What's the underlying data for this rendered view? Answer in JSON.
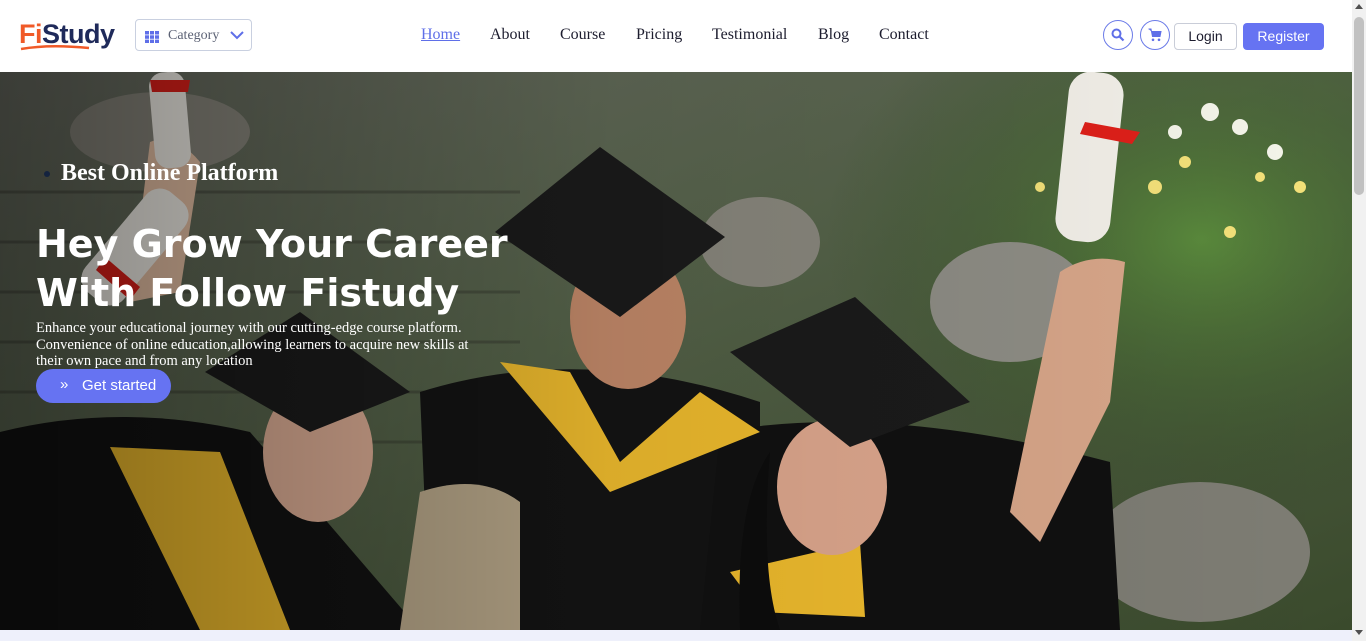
{
  "brand": {
    "logo_fi": "Fi",
    "logo_study": "Study"
  },
  "category": {
    "label": "Category"
  },
  "nav": {
    "items": [
      "Home",
      "About",
      "Course",
      "Pricing",
      "Testimonial",
      "Blog",
      "Contact"
    ],
    "active": "Home"
  },
  "actions": {
    "login": "Login",
    "register": "Register"
  },
  "hero": {
    "tagline": "Best Online Platform",
    "headline_line1": "Hey Grow Your Career",
    "headline_line2": "With Follow Fistudy",
    "description": "Enhance your educational journey with our cutting-edge course platform. Convenience of online education,allowing learners to acquire new skills at their own pace and from any location",
    "cta": "Get started",
    "cta_icon": "double-chevron-right-icon"
  },
  "colors": {
    "accent": "#6673f2",
    "brand_orange": "#f05a28",
    "brand_navy": "#1f2a5a"
  },
  "icons": [
    "grid-icon",
    "chevron-down-icon",
    "search-icon",
    "cart-icon"
  ]
}
